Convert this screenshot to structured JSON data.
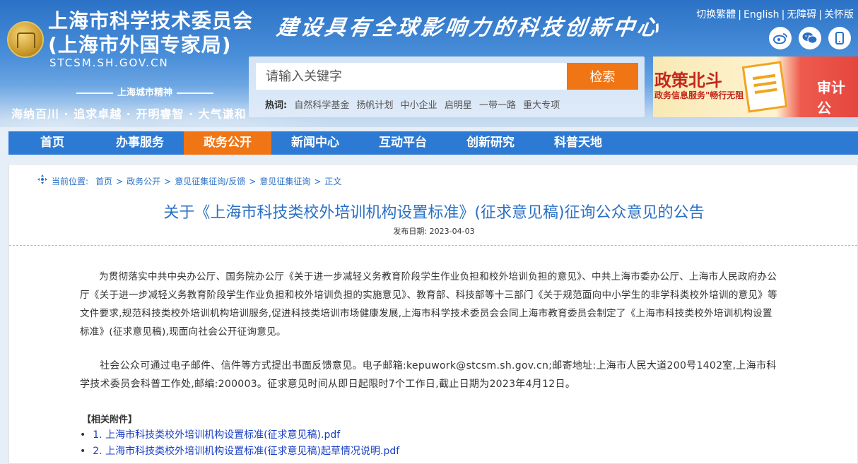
{
  "header": {
    "title_line1": "上海市科学技术委员会",
    "title_line2": "(上海市外国专家局)",
    "domain": "STCSM.SH.GOV.CN",
    "slogan": "建设具有全球影响力的科技创新中心",
    "spirit_label": "上海城市精神",
    "spirit_text": "海纳百川 · 追求卓越 · 开明睿智 · 大气谦和",
    "toplinks": [
      "切换繁體",
      "English",
      "无障碍",
      "关怀版"
    ],
    "social_icons": [
      "weibo-icon",
      "wechat-icon",
      "mobile-icon"
    ]
  },
  "search": {
    "placeholder": "请输入关键字",
    "button": "检索",
    "hot_label": "热词:",
    "hot_words": [
      "自然科学基金",
      "扬帆计划",
      "中小企业",
      "启明星",
      "一带一路",
      "重大专项"
    ]
  },
  "banner": {
    "title": "政策北斗",
    "subtitle": "政务信息服务\"畅行无阻",
    "right_text": "审计公"
  },
  "nav": {
    "items": [
      "首页",
      "办事服务",
      "政务公开",
      "新闻中心",
      "互动平台",
      "创新研究",
      "科普天地"
    ],
    "active_index": 2
  },
  "breadcrumb": {
    "label": "当前位置:",
    "items": [
      "首页",
      "政务公开",
      "意见征集征询/反馈",
      "意见征集征询",
      "正文"
    ]
  },
  "article": {
    "title": "关于《上海市科技类校外培训机构设置标准》(征求意见稿)征询公众意见的公告",
    "date_label": "发布日期:",
    "date": "2023-04-03",
    "paragraph1": "为贯彻落实中共中央办公厅、国务院办公厅《关于进一步减轻义务教育阶段学生作业负担和校外培训负担的意见》、中共上海市委办公厅、上海市人民政府办公厅《关于进一步减轻义务教育阶段学生作业负担和校外培训负担的实施意见》、教育部、科技部等十三部门《关于规范面向中小学生的非学科类校外培训的意见》等文件要求,规范科技类校外培训机构培训服务,促进科技类培训市场健康发展,上海市科学技术委员会会同上海市教育委员会制定了《上海市科技类校外培训机构设置标准》(征求意见稿),现面向社会公开征询意见。",
    "paragraph2": "社会公众可通过电子邮件、信件等方式提出书面反馈意见。电子邮箱:kepuwork@stcsm.sh.gov.cn;邮寄地址:上海市人民大道200号1402室,上海市科学技术委员会科普工作处,邮编:200003。征求意见时间从即日起限时7个工作日,截止日期为2023年4月12日。",
    "attachments_heading": "【相关附件】",
    "attachments": [
      "1. 上海市科技类校外培训机构设置标准(征求意见稿).pdf",
      "2. 上海市科技类校外培训机构设置标准(征求意见稿)起草情况说明.pdf"
    ]
  },
  "colors": {
    "primary_blue": "#2c7ad4",
    "accent_orange": "#f07514",
    "link_blue": "#2a6fc4"
  }
}
